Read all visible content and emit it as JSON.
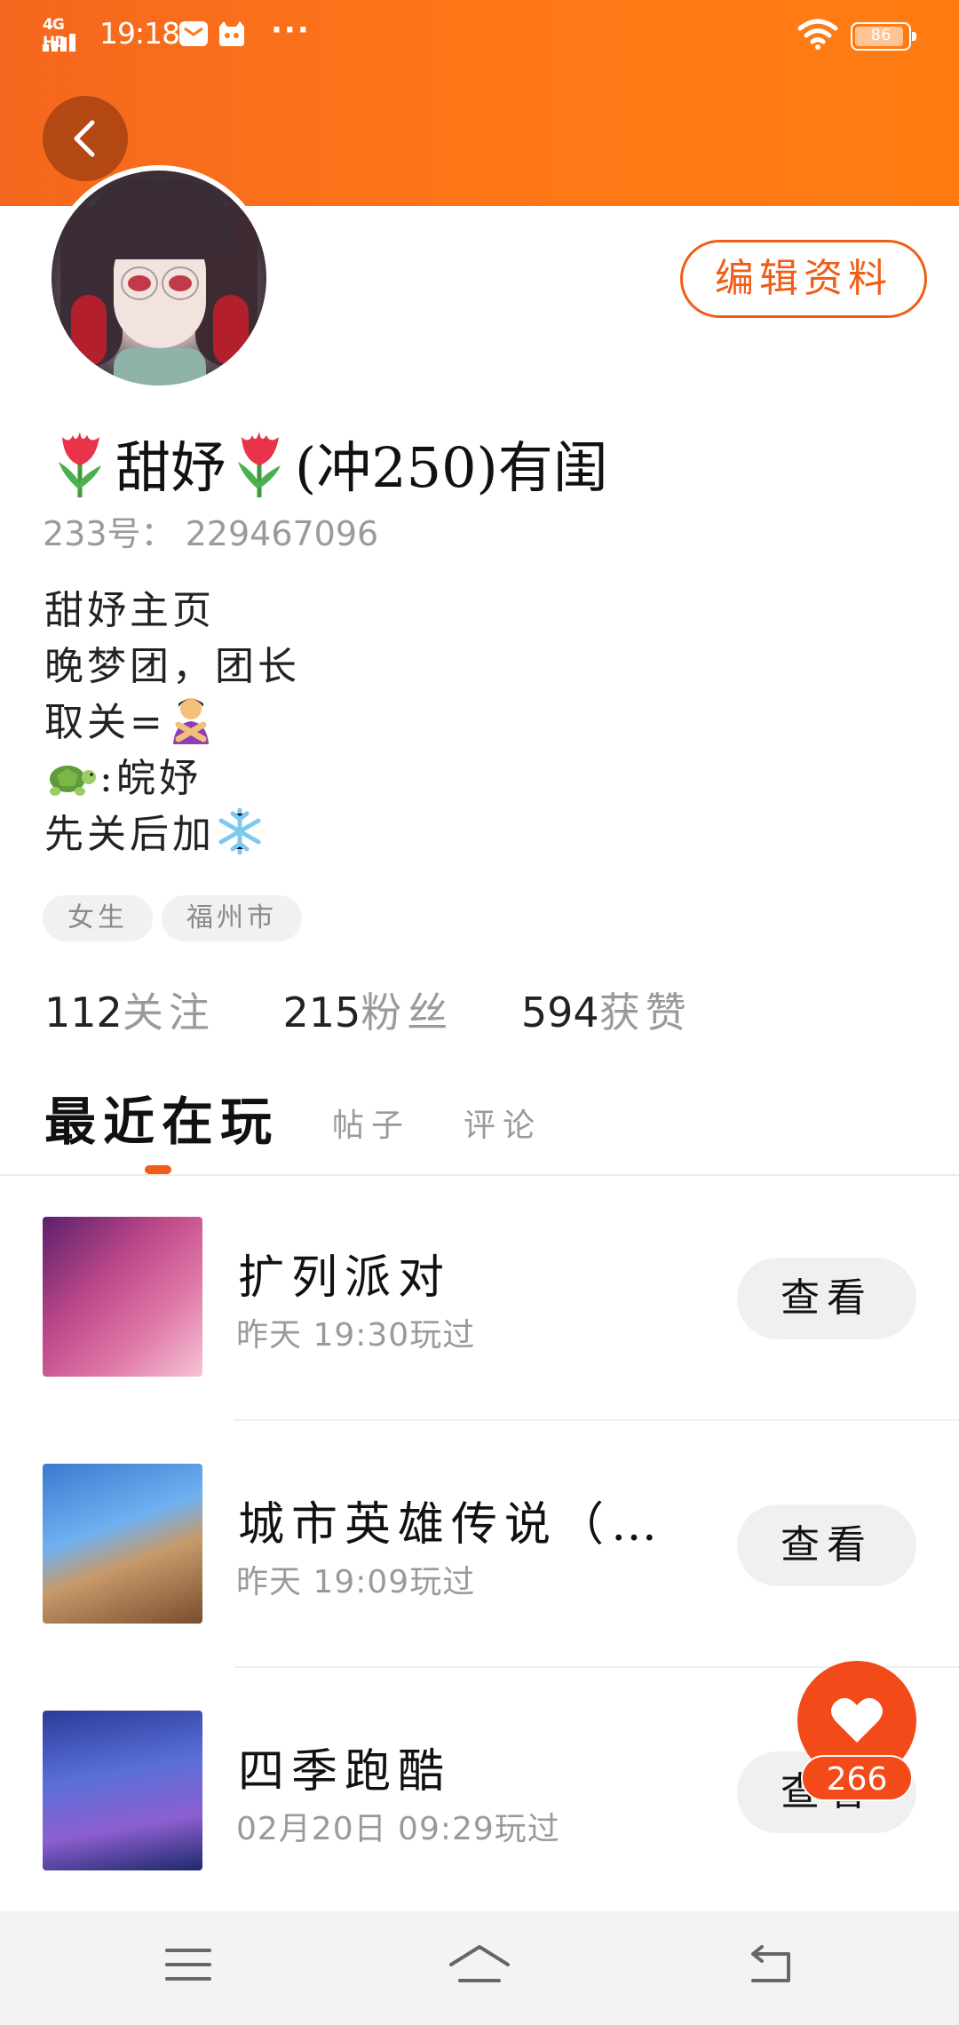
{
  "status_bar": {
    "network": "4G HD",
    "time": "19:18",
    "more": "···",
    "battery": "86"
  },
  "profile": {
    "edit_label": "编辑资料",
    "nickname_part1": "甜妤",
    "nickname_part2": "(冲250)有闺",
    "uid_label": "233号：",
    "uid_value": "229467096",
    "bio": {
      "line1": "甜妤主页",
      "line2": "晚梦团，团长",
      "line3": "取关=",
      "line4": ":皖妤",
      "line5": "先关后加"
    },
    "tags": [
      "女生",
      "福州市"
    ],
    "stats": [
      {
        "num": "112",
        "label": "关注"
      },
      {
        "num": "215",
        "label": "粉丝"
      },
      {
        "num": "594",
        "label": "获赞"
      }
    ]
  },
  "tabs": [
    "最近在玩",
    "帖子",
    "评论"
  ],
  "games": [
    {
      "title": "扩列派对",
      "time": "昨天 19:30玩过",
      "button": "查看"
    },
    {
      "title": "城市英雄传说（…",
      "time": "昨天 19:09玩过",
      "button": "查看"
    },
    {
      "title": "四季跑酷",
      "time": "02月20日 09:29玩过",
      "button": "查看"
    }
  ],
  "fab": {
    "count": "266"
  },
  "icons": {
    "back": "chevron-left-icon",
    "wifi": "wifi-icon",
    "like": "heart-icon",
    "nav_menu": "menu-icon",
    "nav_home": "home-icon",
    "nav_back": "back-icon"
  },
  "colors": {
    "accent": "#f05d17",
    "header_orange": "#ff7a16"
  }
}
